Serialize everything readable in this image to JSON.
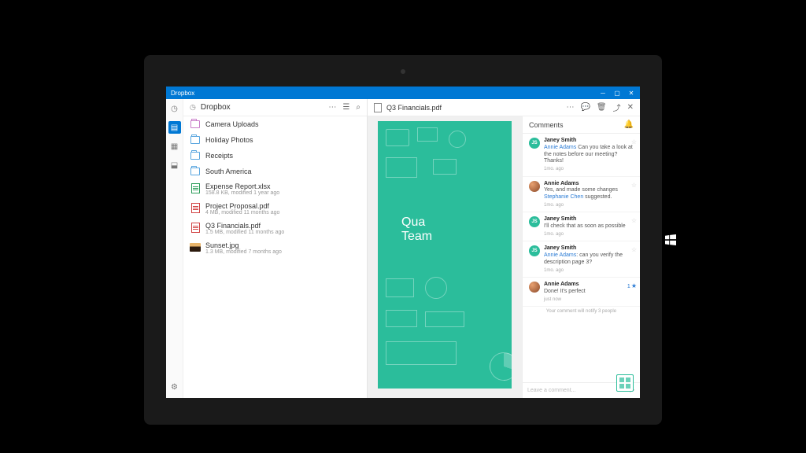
{
  "window": {
    "title": "Dropbox"
  },
  "left": {
    "title": "Dropbox",
    "folders": [
      {
        "name": "Camera Uploads",
        "special": true
      },
      {
        "name": "Holiday Photos"
      },
      {
        "name": "Receipts"
      },
      {
        "name": "South America"
      }
    ],
    "files": [
      {
        "name": "Expense Report.xlsx",
        "meta": "158.8 KB, modified 1 year ago",
        "kind": "xlsx"
      },
      {
        "name": "Project Proposal.pdf",
        "meta": "4 MB, modified 11 months ago",
        "kind": "pdf"
      },
      {
        "name": "Q3 Financials.pdf",
        "meta": "1.5 MB, modified 11 months ago",
        "kind": "pdf"
      },
      {
        "name": "Sunset.jpg",
        "meta": "1.3 MB, modified 7 months ago",
        "kind": "img"
      }
    ]
  },
  "right": {
    "title": "Q3 Financials.pdf",
    "doc_line1": "Qua",
    "doc_line2": "Team"
  },
  "comments": {
    "title": "Comments",
    "items": [
      {
        "avatar": "JS",
        "avclass": "js",
        "author": "Janey Smith",
        "mention": "Annie Adams",
        "text": " Can you take a look at the notes before our meeting? Thanks!",
        "time": "1mo. ago",
        "star": false
      },
      {
        "avatar": "",
        "avclass": "aa",
        "author": "Annie Adams",
        "mention": "Stephanie Chen",
        "pre": "Yes, and made some changes ",
        "text": " suggested.",
        "time": "1mo. ago",
        "star": false
      },
      {
        "avatar": "JS",
        "avclass": "js",
        "author": "Janey Smith",
        "mention": "",
        "text": "I'll check that as soon as possible",
        "time": "1mo. ago",
        "star": false
      },
      {
        "avatar": "JS",
        "avclass": "js",
        "author": "Janey Smith",
        "mention": "Annie Adams",
        "text": ": can you verify the description page 3?",
        "time": "1mo. ago",
        "star": false
      },
      {
        "avatar": "",
        "avclass": "aa",
        "author": "Annie Adams",
        "mention": "",
        "text": "Done! It's perfect",
        "time": "just now",
        "star": true,
        "starCount": "1"
      }
    ],
    "notify": "Your comment will notify 3 people",
    "placeholder": "Leave a comment..."
  }
}
